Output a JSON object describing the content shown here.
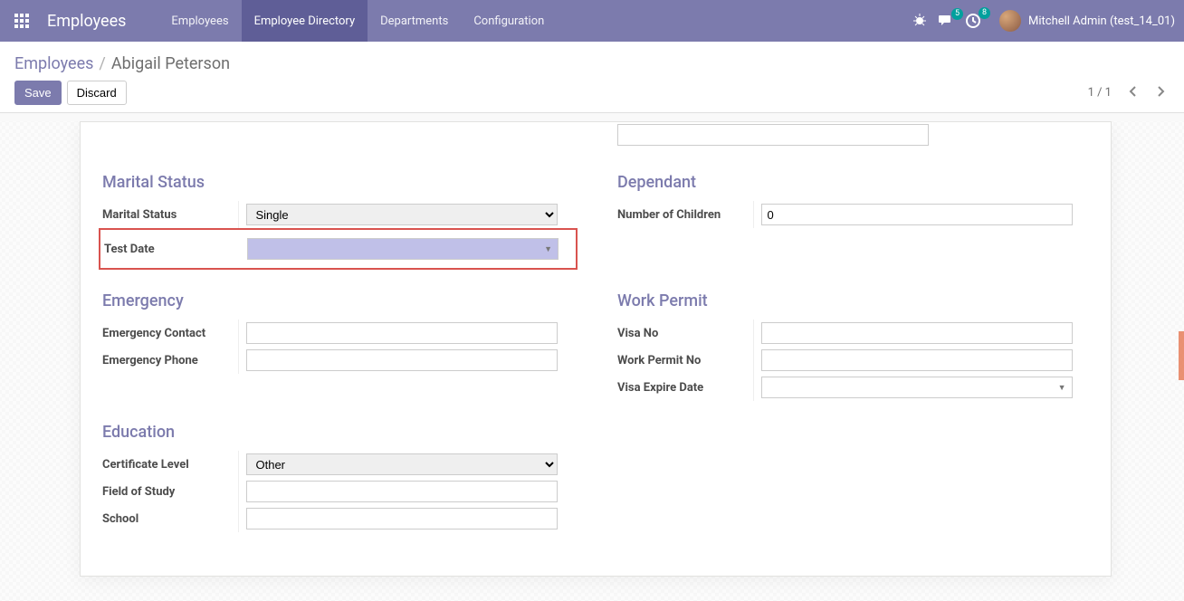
{
  "navbar": {
    "brand": "Employees",
    "menu": [
      "Employees",
      "Employee Directory",
      "Departments",
      "Configuration"
    ],
    "active_index": 1,
    "discuss_badge": "5",
    "activities_badge": "8",
    "username": "Mitchell Admin (test_14_01)"
  },
  "breadcrumb": {
    "root": "Employees",
    "current": "Abigail Peterson"
  },
  "controls": {
    "save": "Save",
    "discard": "Discard",
    "pager": "1 / 1"
  },
  "sections": {
    "marital": {
      "title": "Marital Status",
      "marital_label": "Marital Status",
      "marital_value": "Single",
      "test_date_label": "Test Date",
      "test_date_value": ""
    },
    "dependant": {
      "title": "Dependant",
      "children_label": "Number of Children",
      "children_value": "0"
    },
    "emergency": {
      "title": "Emergency",
      "contact_label": "Emergency Contact",
      "contact_value": "",
      "phone_label": "Emergency Phone",
      "phone_value": ""
    },
    "workpermit": {
      "title": "Work Permit",
      "visa_no_label": "Visa No",
      "visa_no_value": "",
      "permit_no_label": "Work Permit No",
      "permit_no_value": "",
      "visa_expire_label": "Visa Expire Date",
      "visa_expire_value": ""
    },
    "education": {
      "title": "Education",
      "certificate_label": "Certificate Level",
      "certificate_value": "Other",
      "field_label": "Field of Study",
      "field_value": "",
      "school_label": "School",
      "school_value": ""
    }
  }
}
